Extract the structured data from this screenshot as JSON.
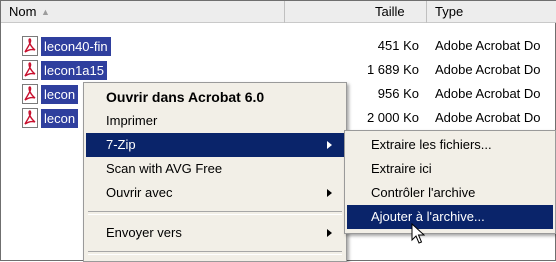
{
  "header": {
    "name": "Nom",
    "size": "Taille",
    "type": "Type"
  },
  "files": [
    {
      "name": "lecon40-fin",
      "size": "451 Ko",
      "type": "Adobe Acrobat Do"
    },
    {
      "name": "lecon1a15",
      "size": "1 689 Ko",
      "type": "Adobe Acrobat Do"
    },
    {
      "name": "lecon",
      "size": "956 Ko",
      "type": "Adobe Acrobat Do"
    },
    {
      "name": "lecon",
      "size": "2 000 Ko",
      "type": "Adobe Acrobat Do"
    }
  ],
  "context_menu": {
    "open_acrobat": "Ouvrir dans Acrobat 6.0",
    "print": "Imprimer",
    "seven_zip": "7-Zip",
    "scan_avg": "Scan with AVG Free",
    "open_with": "Ouvrir avec",
    "send_to": "Envoyer vers"
  },
  "submenu_7zip": {
    "extract_files": "Extraire les fichiers...",
    "extract_here": "Extraire ici",
    "test_archive": "Contrôler l'archive",
    "add_to_archive": "Ajouter à l'archive..."
  },
  "colors": {
    "selection": "#0a246a",
    "file_highlight": "#2f3f9e",
    "menu_bg": "#f2efe7"
  }
}
